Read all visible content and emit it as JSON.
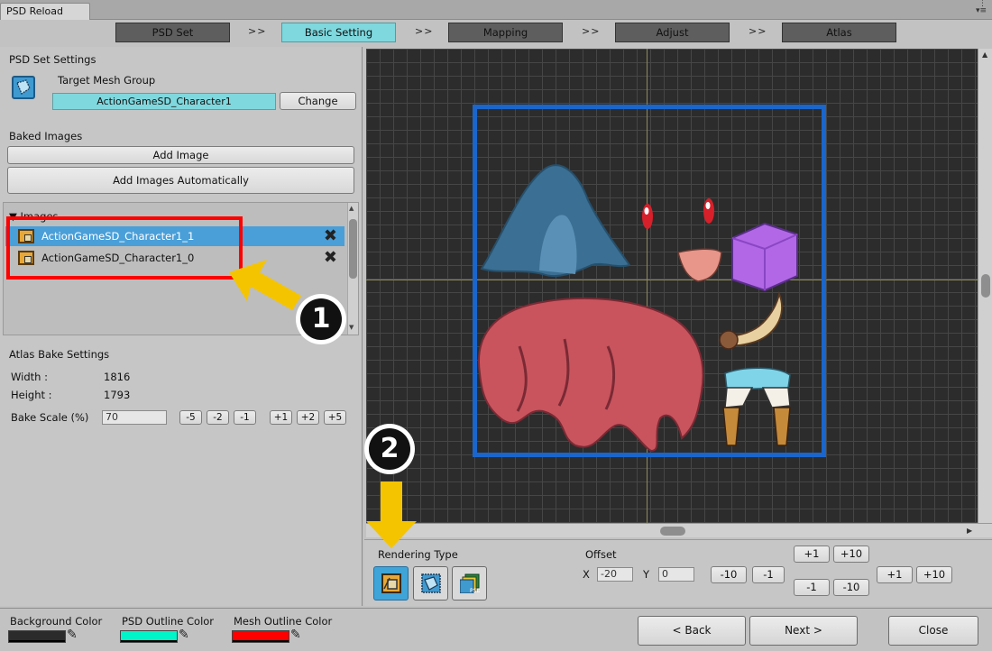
{
  "window": {
    "tab_title": "PSD Reload",
    "controls": "⋮\n▾≡"
  },
  "steps": [
    {
      "label": "PSD Set",
      "active": false
    },
    {
      "label": "Basic Setting",
      "active": true
    },
    {
      "label": "Mapping",
      "active": false
    },
    {
      "label": "Adjust",
      "active": false
    },
    {
      "label": "Atlas",
      "active": false
    }
  ],
  "step_separator": ">>",
  "psd_set": {
    "section_title": "PSD Set Settings",
    "target_mesh_label": "Target Mesh Group",
    "target_mesh_value": "ActionGameSD_Character1",
    "change_button": "Change"
  },
  "baked_images": {
    "section_title": "Baked Images",
    "add_image": "Add Image",
    "add_images_auto": "Add Images Automatically",
    "list_header": "▼  Images",
    "items": [
      {
        "label": "ActionGameSD_Character1_1",
        "selected": true
      },
      {
        "label": "ActionGameSD_Character1_0",
        "selected": false
      }
    ],
    "delete_glyph": "✖"
  },
  "atlas": {
    "section_title": "Atlas Bake Settings",
    "width_label": "Width :",
    "width_value": "1816",
    "height_label": "Height :",
    "height_value": "1793",
    "scale_label": "Bake Scale (%)",
    "scale_value": "70",
    "scale_buttons": [
      "-5",
      "-2",
      "-1",
      "+1",
      "+2",
      "+5"
    ]
  },
  "annotations": {
    "badge1": "1",
    "badge2": "2",
    "highlight_color": "#ff0000",
    "arrow_color": "#f5c400"
  },
  "rendering": {
    "label": "Rendering Type",
    "buttons": [
      {
        "icon": "image-render-icon",
        "active": true
      },
      {
        "icon": "mesh-render-icon",
        "active": false
      },
      {
        "icon": "psd-render-icon",
        "active": false
      }
    ]
  },
  "offset": {
    "label": "Offset",
    "x_label": "X",
    "x_value": "-20",
    "y_label": "Y",
    "y_value": "0",
    "x_minus": [
      "-10",
      "-1"
    ],
    "x_plus": [
      "+1",
      "+10"
    ],
    "y_up": [
      "+1",
      "+10"
    ],
    "y_down": [
      "-1",
      "-10"
    ]
  },
  "footer": {
    "bg_color_label": "Background Color",
    "bg_color": "#2b2b2b",
    "psd_outline_label": "PSD Outline Color",
    "psd_outline_color": "#00f5c8",
    "mesh_outline_label": "Mesh Outline Color",
    "mesh_outline_color": "#ff0000",
    "back": "< Back",
    "next": "Next >",
    "close": "Close"
  }
}
